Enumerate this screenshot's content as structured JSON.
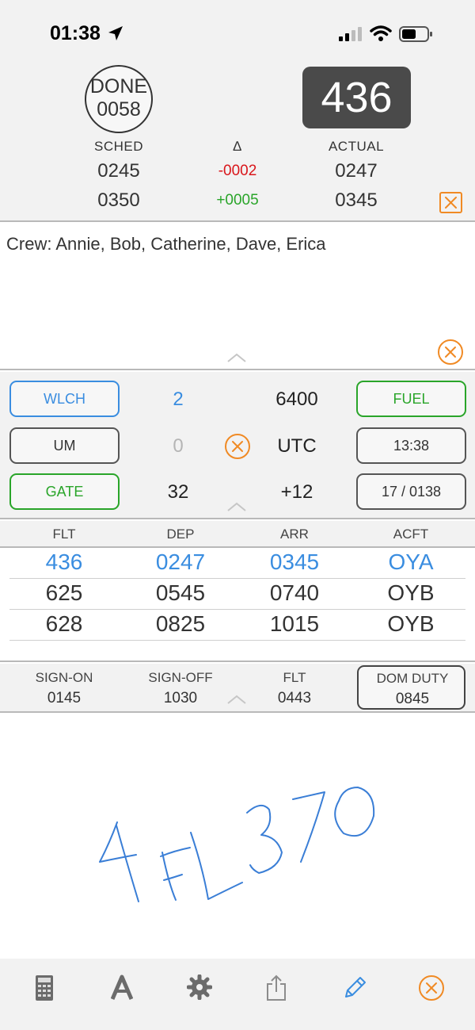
{
  "status_bar": {
    "time": "01:38"
  },
  "summary": {
    "done_label": "DONE",
    "done_value": "0058",
    "current_flight": "436",
    "headers": {
      "sched": "SCHED",
      "delta": "∆",
      "actual": "ACTUAL"
    },
    "rows": [
      {
        "sched": "0245",
        "delta": "-0002",
        "actual": "0247"
      },
      {
        "sched": "0350",
        "delta": "+0005",
        "actual": "0345"
      }
    ]
  },
  "crew": {
    "text": "Crew: Annie, Bob, Catherine, Dave, Erica"
  },
  "controls": {
    "wlch_label": "WLCH",
    "wlch_value": "2",
    "fuel_value": "6400",
    "fuel_label": "FUEL",
    "um_label": "UM",
    "um_value": "0",
    "utc_label": "UTC",
    "utc_time": "13:38",
    "gate_label": "GATE",
    "gate_value": "32",
    "utc_offset": "+12",
    "date_code": "17 / 0138"
  },
  "flights": {
    "headers": [
      "FLT",
      "DEP",
      "ARR",
      "ACFT"
    ],
    "rows": [
      {
        "flt": "436",
        "dep": "0247",
        "arr": "0345",
        "acft": "OYA"
      },
      {
        "flt": "625",
        "dep": "0545",
        "arr": "0740",
        "acft": "OYB"
      },
      {
        "flt": "628",
        "dep": "0825",
        "arr": "1015",
        "acft": "OYB"
      }
    ]
  },
  "duty": {
    "sign_on_label": "SIGN-ON",
    "sign_on": "0145",
    "sign_off_label": "SIGN-OFF",
    "sign_off": "1030",
    "flt_label": "FLT",
    "flt": "0443",
    "dom_duty_label": "DOM DUTY",
    "dom_duty": "0845"
  },
  "notes": {
    "handwriting": "4 FL370"
  },
  "colors": {
    "accent_blue": "#3a8de0",
    "accent_green": "#2aa52a",
    "alert_red": "#d9161b",
    "clear_orange": "#f08a24"
  }
}
